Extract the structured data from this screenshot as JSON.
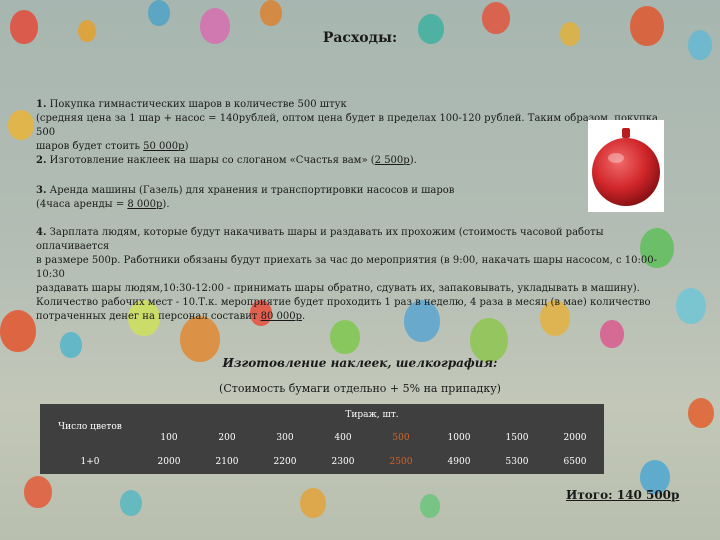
{
  "title": "Расходы:",
  "item1": {
    "num": "1.",
    "text": "Покупка гимнастических шаров в количестве 500 штук",
    "line2": "(средняя цена за 1 шар + насос = 140рублей, оптом цена будет в пределах 100-120 рублей. Таким образом, покупка 500",
    "line3": "шаров будет стоить ",
    "amount": "50 000р",
    "end": ")"
  },
  "item2": {
    "num": "2.",
    "text": "Изготовление наклеек на шары со слоганом «Счастья вам» (",
    "amount": "2 500р",
    "end": ")."
  },
  "item3": {
    "num": "3.",
    "text": "Аренда машины (Газель) для хранения и транспортировки насосов и шаров",
    "line2": "(4часа аренды = ",
    "amount": "8 000р",
    "end": ")."
  },
  "item4": {
    "num": "4.",
    "text": "Зарплата людям, которые будут накачивать шары и раздавать их прохожим (стоимость часовой работы оплачивается",
    "line2": "в размере 500р. Работники  обязаны будут приехать за час до мероприятия (в 9:00, накачать шары насосом, с 10:00-10:30",
    "line3": "раздавать шары людям,10:30-12:00 - принимать шары обратно, сдувать их, запаковывать, укладывать в машину).",
    "line4": "Количество рабочих мест - 10.Т.к. мероприятие будет проходить 1 раз в неделю, 4 раза в месяц (в мае) количество",
    "line5": "потраченных денег на персонал составит  ",
    "amount": "80 000р",
    "end": "."
  },
  "section": {
    "heading": "Изготовление наклеек, шелкография:",
    "note": "(Стоимость бумаги отдельно + 5% на припадку)"
  },
  "table": {
    "colors_label": "Число цветов",
    "tirazh_label": "Тираж, шт.",
    "quantities": [
      "100",
      "200",
      "300",
      "400",
      "500",
      "1000",
      "1500",
      "2000"
    ],
    "row_label": "1+0",
    "prices": [
      "2000",
      "2100",
      "2200",
      "2300",
      "2500",
      "4900",
      "5300",
      "6500"
    ],
    "highlight_color": "#d2632a"
  },
  "total": "Итого: 140 500р"
}
